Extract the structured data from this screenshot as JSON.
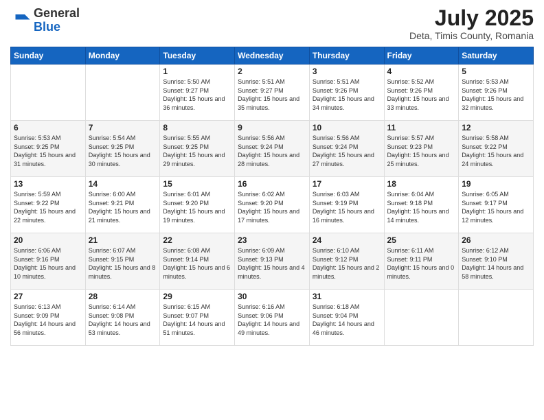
{
  "logo": {
    "general": "General",
    "blue": "Blue"
  },
  "header": {
    "month_year": "July 2025",
    "location": "Deta, Timis County, Romania"
  },
  "days_of_week": [
    "Sunday",
    "Monday",
    "Tuesday",
    "Wednesday",
    "Thursday",
    "Friday",
    "Saturday"
  ],
  "weeks": [
    [
      {
        "day": "",
        "detail": ""
      },
      {
        "day": "",
        "detail": ""
      },
      {
        "day": "1",
        "detail": "Sunrise: 5:50 AM\nSunset: 9:27 PM\nDaylight: 15 hours and 36 minutes."
      },
      {
        "day": "2",
        "detail": "Sunrise: 5:51 AM\nSunset: 9:27 PM\nDaylight: 15 hours and 35 minutes."
      },
      {
        "day": "3",
        "detail": "Sunrise: 5:51 AM\nSunset: 9:26 PM\nDaylight: 15 hours and 34 minutes."
      },
      {
        "day": "4",
        "detail": "Sunrise: 5:52 AM\nSunset: 9:26 PM\nDaylight: 15 hours and 33 minutes."
      },
      {
        "day": "5",
        "detail": "Sunrise: 5:53 AM\nSunset: 9:26 PM\nDaylight: 15 hours and 32 minutes."
      }
    ],
    [
      {
        "day": "6",
        "detail": "Sunrise: 5:53 AM\nSunset: 9:25 PM\nDaylight: 15 hours and 31 minutes."
      },
      {
        "day": "7",
        "detail": "Sunrise: 5:54 AM\nSunset: 9:25 PM\nDaylight: 15 hours and 30 minutes."
      },
      {
        "day": "8",
        "detail": "Sunrise: 5:55 AM\nSunset: 9:25 PM\nDaylight: 15 hours and 29 minutes."
      },
      {
        "day": "9",
        "detail": "Sunrise: 5:56 AM\nSunset: 9:24 PM\nDaylight: 15 hours and 28 minutes."
      },
      {
        "day": "10",
        "detail": "Sunrise: 5:56 AM\nSunset: 9:24 PM\nDaylight: 15 hours and 27 minutes."
      },
      {
        "day": "11",
        "detail": "Sunrise: 5:57 AM\nSunset: 9:23 PM\nDaylight: 15 hours and 25 minutes."
      },
      {
        "day": "12",
        "detail": "Sunrise: 5:58 AM\nSunset: 9:22 PM\nDaylight: 15 hours and 24 minutes."
      }
    ],
    [
      {
        "day": "13",
        "detail": "Sunrise: 5:59 AM\nSunset: 9:22 PM\nDaylight: 15 hours and 22 minutes."
      },
      {
        "day": "14",
        "detail": "Sunrise: 6:00 AM\nSunset: 9:21 PM\nDaylight: 15 hours and 21 minutes."
      },
      {
        "day": "15",
        "detail": "Sunrise: 6:01 AM\nSunset: 9:20 PM\nDaylight: 15 hours and 19 minutes."
      },
      {
        "day": "16",
        "detail": "Sunrise: 6:02 AM\nSunset: 9:20 PM\nDaylight: 15 hours and 17 minutes."
      },
      {
        "day": "17",
        "detail": "Sunrise: 6:03 AM\nSunset: 9:19 PM\nDaylight: 15 hours and 16 minutes."
      },
      {
        "day": "18",
        "detail": "Sunrise: 6:04 AM\nSunset: 9:18 PM\nDaylight: 15 hours and 14 minutes."
      },
      {
        "day": "19",
        "detail": "Sunrise: 6:05 AM\nSunset: 9:17 PM\nDaylight: 15 hours and 12 minutes."
      }
    ],
    [
      {
        "day": "20",
        "detail": "Sunrise: 6:06 AM\nSunset: 9:16 PM\nDaylight: 15 hours and 10 minutes."
      },
      {
        "day": "21",
        "detail": "Sunrise: 6:07 AM\nSunset: 9:15 PM\nDaylight: 15 hours and 8 minutes."
      },
      {
        "day": "22",
        "detail": "Sunrise: 6:08 AM\nSunset: 9:14 PM\nDaylight: 15 hours and 6 minutes."
      },
      {
        "day": "23",
        "detail": "Sunrise: 6:09 AM\nSunset: 9:13 PM\nDaylight: 15 hours and 4 minutes."
      },
      {
        "day": "24",
        "detail": "Sunrise: 6:10 AM\nSunset: 9:12 PM\nDaylight: 15 hours and 2 minutes."
      },
      {
        "day": "25",
        "detail": "Sunrise: 6:11 AM\nSunset: 9:11 PM\nDaylight: 15 hours and 0 minutes."
      },
      {
        "day": "26",
        "detail": "Sunrise: 6:12 AM\nSunset: 9:10 PM\nDaylight: 14 hours and 58 minutes."
      }
    ],
    [
      {
        "day": "27",
        "detail": "Sunrise: 6:13 AM\nSunset: 9:09 PM\nDaylight: 14 hours and 56 minutes."
      },
      {
        "day": "28",
        "detail": "Sunrise: 6:14 AM\nSunset: 9:08 PM\nDaylight: 14 hours and 53 minutes."
      },
      {
        "day": "29",
        "detail": "Sunrise: 6:15 AM\nSunset: 9:07 PM\nDaylight: 14 hours and 51 minutes."
      },
      {
        "day": "30",
        "detail": "Sunrise: 6:16 AM\nSunset: 9:06 PM\nDaylight: 14 hours and 49 minutes."
      },
      {
        "day": "31",
        "detail": "Sunrise: 6:18 AM\nSunset: 9:04 PM\nDaylight: 14 hours and 46 minutes."
      },
      {
        "day": "",
        "detail": ""
      },
      {
        "day": "",
        "detail": ""
      }
    ]
  ]
}
